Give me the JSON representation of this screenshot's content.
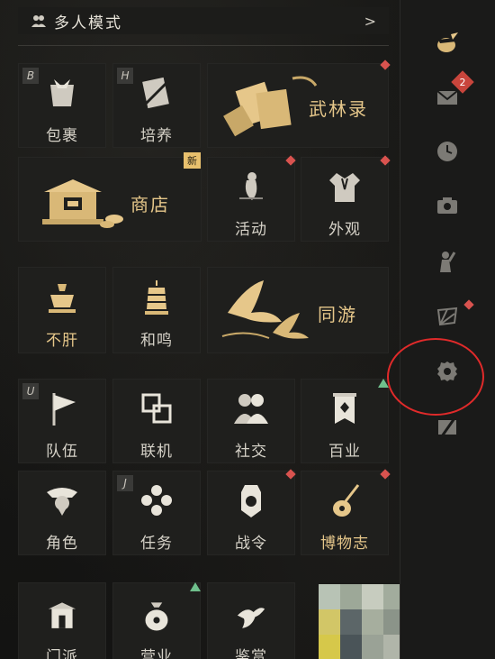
{
  "header": {
    "title": "多人模式",
    "chevron": ">"
  },
  "sidebar": {
    "items": [
      {
        "name": "avatar-icon"
      },
      {
        "name": "mail-icon",
        "badge": "2"
      },
      {
        "name": "clock-icon"
      },
      {
        "name": "camera-icon"
      },
      {
        "name": "gesture-icon"
      },
      {
        "name": "fan-icon"
      },
      {
        "name": "gear-icon"
      },
      {
        "name": "slash-icon"
      }
    ]
  },
  "tiles": {
    "baoguo": {
      "label": "包裹",
      "hotkey": "B"
    },
    "peiyang": {
      "label": "培养",
      "hotkey": "H"
    },
    "wulinlu": {
      "label": "武林录"
    },
    "shangdian": {
      "label": "商店",
      "badge": "新"
    },
    "huodong": {
      "label": "活动"
    },
    "waiguan": {
      "label": "外观"
    },
    "bugan": {
      "label": "不肝"
    },
    "heming": {
      "label": "和鸣"
    },
    "tongyou": {
      "label": "同游"
    },
    "duiwu": {
      "label": "队伍",
      "hotkey": "U"
    },
    "lianji": {
      "label": "联机"
    },
    "shejiao": {
      "label": "社交"
    },
    "baiye": {
      "label": "百业"
    },
    "juese": {
      "label": "角色"
    },
    "renwu": {
      "label": "任务",
      "hotkey": "J"
    },
    "zhanling": {
      "label": "战令"
    },
    "bowuzhi": {
      "label": "博物志"
    },
    "menpai": {
      "label": "门派"
    },
    "yingye": {
      "label": "营业"
    },
    "jianshang": {
      "label": "鉴赏"
    }
  },
  "colors": {
    "gold": "#e6c78a",
    "red_dot": "#d9534f",
    "annotation": "#e02a2a",
    "green": "#6fbf8c"
  }
}
